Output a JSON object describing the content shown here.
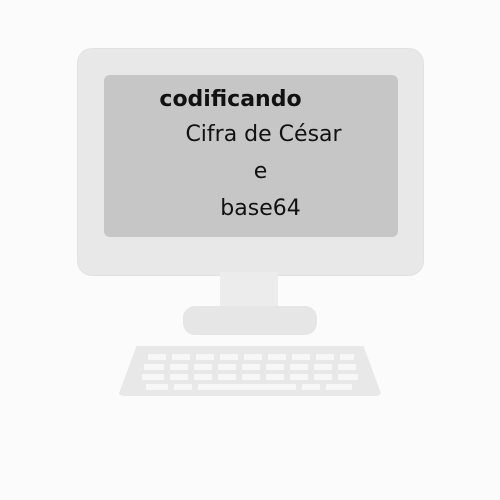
{
  "screen": {
    "title": "codificando",
    "line2": "Cifra de César",
    "line3": "e",
    "line4": "base64"
  },
  "illustration": {
    "object": "desktop-computer",
    "colors": {
      "background": "#fbfbfb",
      "frame": "#e8e8e8",
      "screen": "#c6c6c6",
      "text": "#111111"
    }
  }
}
